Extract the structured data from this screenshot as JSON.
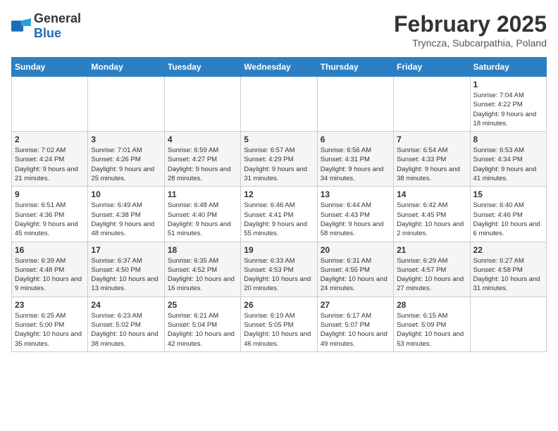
{
  "logo": {
    "general": "General",
    "blue": "Blue"
  },
  "header": {
    "month_year": "February 2025",
    "location": "Tryncza, Subcarpathia, Poland"
  },
  "weekdays": [
    "Sunday",
    "Monday",
    "Tuesday",
    "Wednesday",
    "Thursday",
    "Friday",
    "Saturday"
  ],
  "weeks": [
    [
      {
        "day": "",
        "info": ""
      },
      {
        "day": "",
        "info": ""
      },
      {
        "day": "",
        "info": ""
      },
      {
        "day": "",
        "info": ""
      },
      {
        "day": "",
        "info": ""
      },
      {
        "day": "",
        "info": ""
      },
      {
        "day": "1",
        "info": "Sunrise: 7:04 AM\nSunset: 4:22 PM\nDaylight: 9 hours and 18 minutes."
      }
    ],
    [
      {
        "day": "2",
        "info": "Sunrise: 7:02 AM\nSunset: 4:24 PM\nDaylight: 9 hours and 21 minutes."
      },
      {
        "day": "3",
        "info": "Sunrise: 7:01 AM\nSunset: 4:26 PM\nDaylight: 9 hours and 25 minutes."
      },
      {
        "day": "4",
        "info": "Sunrise: 6:59 AM\nSunset: 4:27 PM\nDaylight: 9 hours and 28 minutes."
      },
      {
        "day": "5",
        "info": "Sunrise: 6:57 AM\nSunset: 4:29 PM\nDaylight: 9 hours and 31 minutes."
      },
      {
        "day": "6",
        "info": "Sunrise: 6:56 AM\nSunset: 4:31 PM\nDaylight: 9 hours and 34 minutes."
      },
      {
        "day": "7",
        "info": "Sunrise: 6:54 AM\nSunset: 4:33 PM\nDaylight: 9 hours and 38 minutes."
      },
      {
        "day": "8",
        "info": "Sunrise: 6:53 AM\nSunset: 4:34 PM\nDaylight: 9 hours and 41 minutes."
      }
    ],
    [
      {
        "day": "9",
        "info": "Sunrise: 6:51 AM\nSunset: 4:36 PM\nDaylight: 9 hours and 45 minutes."
      },
      {
        "day": "10",
        "info": "Sunrise: 6:49 AM\nSunset: 4:38 PM\nDaylight: 9 hours and 48 minutes."
      },
      {
        "day": "11",
        "info": "Sunrise: 6:48 AM\nSunset: 4:40 PM\nDaylight: 9 hours and 51 minutes."
      },
      {
        "day": "12",
        "info": "Sunrise: 6:46 AM\nSunset: 4:41 PM\nDaylight: 9 hours and 55 minutes."
      },
      {
        "day": "13",
        "info": "Sunrise: 6:44 AM\nSunset: 4:43 PM\nDaylight: 9 hours and 58 minutes."
      },
      {
        "day": "14",
        "info": "Sunrise: 6:42 AM\nSunset: 4:45 PM\nDaylight: 10 hours and 2 minutes."
      },
      {
        "day": "15",
        "info": "Sunrise: 6:40 AM\nSunset: 4:46 PM\nDaylight: 10 hours and 6 minutes."
      }
    ],
    [
      {
        "day": "16",
        "info": "Sunrise: 6:39 AM\nSunset: 4:48 PM\nDaylight: 10 hours and 9 minutes."
      },
      {
        "day": "17",
        "info": "Sunrise: 6:37 AM\nSunset: 4:50 PM\nDaylight: 10 hours and 13 minutes."
      },
      {
        "day": "18",
        "info": "Sunrise: 6:35 AM\nSunset: 4:52 PM\nDaylight: 10 hours and 16 minutes."
      },
      {
        "day": "19",
        "info": "Sunrise: 6:33 AM\nSunset: 4:53 PM\nDaylight: 10 hours and 20 minutes."
      },
      {
        "day": "20",
        "info": "Sunrise: 6:31 AM\nSunset: 4:55 PM\nDaylight: 10 hours and 24 minutes."
      },
      {
        "day": "21",
        "info": "Sunrise: 6:29 AM\nSunset: 4:57 PM\nDaylight: 10 hours and 27 minutes."
      },
      {
        "day": "22",
        "info": "Sunrise: 6:27 AM\nSunset: 4:58 PM\nDaylight: 10 hours and 31 minutes."
      }
    ],
    [
      {
        "day": "23",
        "info": "Sunrise: 6:25 AM\nSunset: 5:00 PM\nDaylight: 10 hours and 35 minutes."
      },
      {
        "day": "24",
        "info": "Sunrise: 6:23 AM\nSunset: 5:02 PM\nDaylight: 10 hours and 38 minutes."
      },
      {
        "day": "25",
        "info": "Sunrise: 6:21 AM\nSunset: 5:04 PM\nDaylight: 10 hours and 42 minutes."
      },
      {
        "day": "26",
        "info": "Sunrise: 6:19 AM\nSunset: 5:05 PM\nDaylight: 10 hours and 46 minutes."
      },
      {
        "day": "27",
        "info": "Sunrise: 6:17 AM\nSunset: 5:07 PM\nDaylight: 10 hours and 49 minutes."
      },
      {
        "day": "28",
        "info": "Sunrise: 6:15 AM\nSunset: 5:09 PM\nDaylight: 10 hours and 53 minutes."
      },
      {
        "day": "",
        "info": ""
      }
    ]
  ]
}
